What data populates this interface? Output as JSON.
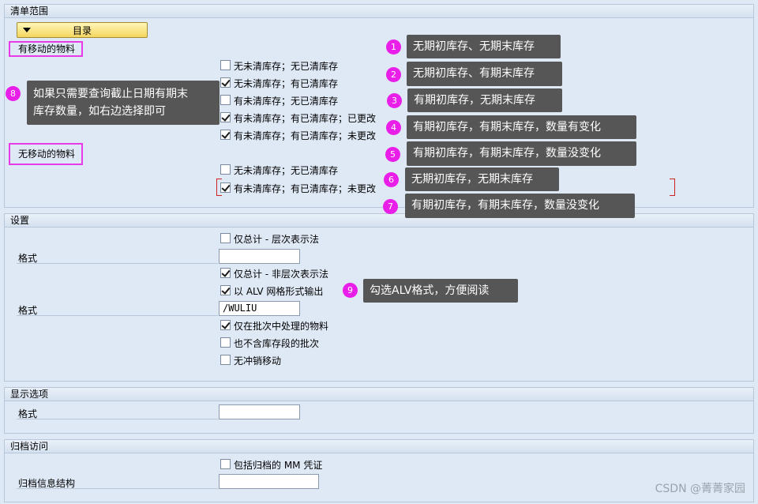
{
  "sections": {
    "scope": "清单范围",
    "settings": "设置",
    "display": "显示选项",
    "archive": "归档访问"
  },
  "scope": {
    "catalog_button": "目录",
    "moved_materials": "有移动的物料",
    "unmoved_materials": "无移动的物料",
    "moved_options": [
      {
        "label": "无未清库存；无已清库存",
        "checked": false
      },
      {
        "label": "无未清库存；有已清库存",
        "checked": true
      },
      {
        "label": "有未清库存；无已清库存",
        "checked": false
      },
      {
        "label": "有未清库存；有已清库存；已更改",
        "checked": true
      },
      {
        "label": "有未清库存；有已清库存；未更改",
        "checked": true
      }
    ],
    "unmoved_options": [
      {
        "label": "无未清库存；无已清库存",
        "checked": false
      },
      {
        "label": "有未清库存；有已清库存；未更改",
        "checked": true
      }
    ]
  },
  "settings": {
    "totals_hier": "仅总计 - 层次表示法",
    "format1_label": "格式",
    "format1_value": "",
    "totals_nonhier": "仅总计 - 非层次表示法",
    "alv_output": "以 ALV 网格形式输出",
    "format2_label": "格式",
    "format2_value": "/WULIU",
    "batch_only": "仅在批次中处理的物料",
    "no_storage_loc": "也不含库存段的批次",
    "no_reversal": "无冲销移动"
  },
  "display": {
    "format_label": "格式",
    "format_value": ""
  },
  "archive": {
    "include_archived": "包括归档的 MM 凭证",
    "info_structure_label": "归档信息结构",
    "info_structure_value": ""
  },
  "annotations": {
    "c1": {
      "num": "1",
      "text": "无期初库存、无期末库存"
    },
    "c2": {
      "num": "2",
      "text": "无期初库存、有期末库存"
    },
    "c3": {
      "num": "3",
      "text": "有期初库存，无期末库存"
    },
    "c4": {
      "num": "4",
      "text": "有期初库存，有期末库存，数量有变化"
    },
    "c5": {
      "num": "5",
      "text": "有期初库存，有期末库存，数量没变化"
    },
    "c6": {
      "num": "6",
      "text": "无期初库存，无期末库存"
    },
    "c7": {
      "num": "7",
      "text": "有期初库存，有期末库存，数量没变化"
    },
    "c8": {
      "num": "8",
      "line1": "如果只需要查询截止日期有期末",
      "line2": "库存数量，如右边选择即可"
    },
    "c9": {
      "num": "9",
      "text": "勾选ALV格式，方便阅读"
    }
  },
  "watermark": "CSDN @菁菁家园",
  "colors": {
    "badge": "#e91ee9",
    "highlight": "#e63be6",
    "callout": "#565656"
  }
}
